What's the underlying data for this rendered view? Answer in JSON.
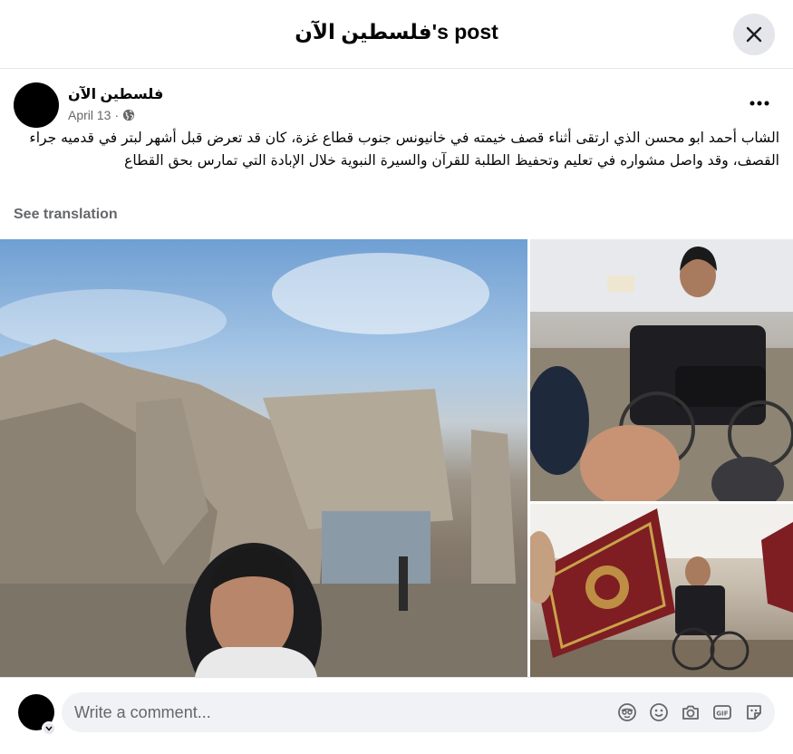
{
  "header": {
    "title": "فلسطين الآن's post"
  },
  "post": {
    "author": "فلسطين الآن",
    "date": "April 13",
    "separator": "·",
    "privacy_icon": "globe-icon",
    "text": "الشاب أحمد ابو محسن الذي ارتقى أثناء قصف خيمته في خانيونس جنوب قطاع غزة، كان قد تعرض قبل أشهر لبتر في قدميه جراء القصف، وقد واصل مشواره في تعليم وتحفيظ الطلبة للقرآن والسيرة النبوية خلال الإبادة التي تمارس بحق القطاع",
    "see_translation": "See translation"
  },
  "photos": [
    {
      "name": "photo-rubble-portrait"
    },
    {
      "name": "photo-wheelchair-class"
    },
    {
      "name": "photo-quran-reading"
    }
  ],
  "comment": {
    "placeholder": "Write a comment...",
    "icons": [
      "avatar-sticker-icon",
      "emoji-icon",
      "camera-icon",
      "gif-icon",
      "sticker-icon"
    ]
  },
  "colors": {
    "secondary_text": "#65676b",
    "input_bg": "#f0f2f5",
    "button_bg": "#e4e6eb"
  }
}
